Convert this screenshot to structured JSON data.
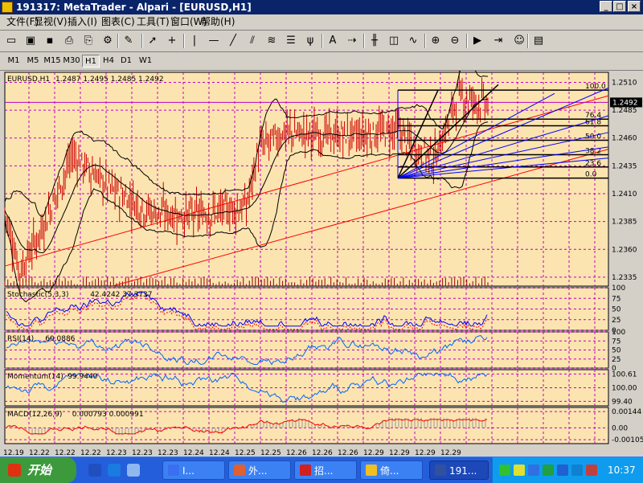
{
  "window": {
    "title": "191317: MetaTrader - Alpari - [EURUSD,H1]"
  },
  "menu": [
    "文件(F)",
    "显视(V)",
    "插入(I)",
    "图表(C)",
    "工具(T)",
    "窗口(W)",
    "帮助(H)"
  ],
  "timeframes": {
    "items": [
      "M1",
      "M5",
      "M15",
      "M30",
      "H1",
      "H4",
      "D1",
      "W1"
    ],
    "active": "H1"
  },
  "toolbar_icons": [
    "new-chart-icon",
    "open-icon",
    "save-icon",
    "print-icon",
    "print-preview-icon",
    "properties-icon",
    "pen-icon",
    "cursor-icon",
    "crosshair-icon",
    "vertical-line-icon",
    "horizontal-line-icon",
    "trendline-icon",
    "channel-icon",
    "fan-icon",
    "fibo-retracement-icon",
    "gann-icon",
    "text-icon",
    "arrow-label-icon",
    "bar-chart-icon",
    "candle-chart-icon",
    "line-chart-icon",
    "zoom-in-icon",
    "zoom-out-icon",
    "autoscroll-icon",
    "chart-shift-icon",
    "expert-icon",
    "terminal-icon"
  ],
  "chart_data": {
    "type": "line",
    "symbol": "EURUSD,H1",
    "ohlc_header": "1.2487 1.2495 1.2485 1.2492",
    "current_price": "1.2492",
    "price_ticks": [
      "1.2510",
      "1.2485",
      "1.2460",
      "1.2435",
      "1.2410",
      "1.2385",
      "1.2360",
      "1.2335"
    ],
    "price_tick_values": [
      1.251,
      1.2485,
      1.246,
      1.2435,
      1.241,
      1.2385,
      1.236,
      1.2335
    ],
    "ylim": [
      1.2327,
      1.2519
    ],
    "x_labels": [
      "12.19",
      "12.22",
      "12.22",
      "12.22",
      "12.23",
      "12.23",
      "12.23",
      "12.24",
      "12.24",
      "12.25",
      "12.25",
      "12.26",
      "12.26",
      "12.26",
      "12.29",
      "12.29",
      "12.29",
      "12.29"
    ],
    "close_anchors": {
      "x": [
        0,
        10,
        25,
        45,
        70,
        95,
        120,
        145,
        160,
        168,
        185,
        210,
        235,
        260,
        272,
        285,
        300,
        320
      ],
      "y": [
        1.2395,
        1.234,
        1.238,
        1.2445,
        1.2415,
        1.2395,
        1.239,
        1.2395,
        1.2398,
        1.245,
        1.2465,
        1.2463,
        1.2462,
        1.2468,
        1.245,
        1.2442,
        1.2498,
        1.249
      ]
    },
    "fibo_levels": {
      "labels": [
        "100.0",
        "76.4",
        "61.8",
        "50.0",
        "38.2",
        "23.6",
        "0.0"
      ],
      "values": [
        1.2503,
        1.2477,
        1.2471,
        1.2458,
        1.2445,
        1.2434,
        1.2424
      ]
    },
    "fibo_range": {
      "low": 1.2424,
      "high": 1.2503
    },
    "indicators": [
      {
        "title": "Stochastic(5,3,3)",
        "values": "42.4242 37.3737",
        "ticks": [
          "100",
          "75",
          "50",
          "25",
          "0"
        ],
        "tick_values": [
          100,
          75,
          50,
          25,
          0
        ],
        "ylim": [
          0,
          100
        ],
        "color": "#0000ff"
      },
      {
        "title": "RSI(14)",
        "values": "60.0886",
        "ticks": [
          "100",
          "75",
          "50",
          "25",
          "0"
        ],
        "tick_values": [
          100,
          75,
          50,
          25,
          0
        ],
        "ylim": [
          0,
          100
        ],
        "color": "#0066ff"
      },
      {
        "title": "Momentum(14)",
        "values": "99.9440",
        "ticks": [
          "100.61",
          "100.00",
          "99.40"
        ],
        "tick_values": [
          100.61,
          100,
          99.4
        ],
        "ylim": [
          99.2,
          100.8
        ],
        "color": "#0066ff"
      },
      {
        "title": "MACD(12,26,9)",
        "values": "0.000793 0.000991",
        "ticks": [
          "0.00144",
          "0.00",
          "-0.00105"
        ],
        "tick_values": [
          0.00144,
          0,
          -0.00105
        ],
        "ylim": [
          -0.0014,
          0.0018
        ],
        "color": "#ff0000"
      }
    ]
  },
  "taskbar": {
    "start_label": "开始",
    "buttons": [
      {
        "label": "I...",
        "icon": "#3a6ff0"
      },
      {
        "label": "外...",
        "icon": "#e06030"
      },
      {
        "label": "招...",
        "icon": "#d02020"
      },
      {
        "label": "倚...",
        "icon": "#f0c020"
      },
      {
        "label": "191...",
        "icon": "#3050a0"
      }
    ],
    "active_button": 4,
    "clock": "10:37"
  }
}
